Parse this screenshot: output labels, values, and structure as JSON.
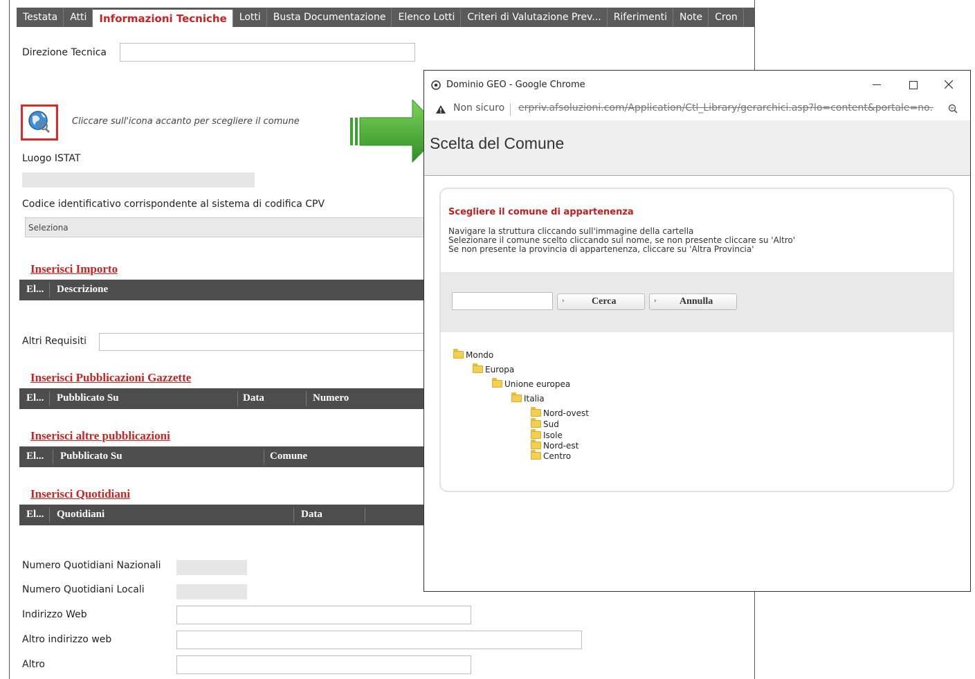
{
  "tabs": [
    "Testata",
    "Atti",
    "Informazioni Tecniche",
    "Lotti",
    "Busta Documentazione",
    "Elenco Lotti",
    "Criteri di Valutazione Prev...",
    "Riferimenti",
    "Note",
    "Cron"
  ],
  "active_tab": "Informazioni Tecniche",
  "form": {
    "direzione_tecnica_label": "Direzione Tecnica",
    "comune_hint": "Cliccare sull'icona accanto per scegliere il comune",
    "luogo_istat_label": "Luogo ISTAT",
    "cpv_label": "Codice identificativo corrispondente al sistema di codifica CPV",
    "cpv_value": "Seleziona",
    "inserisci_importo": "Inserisci Importo",
    "importo_cols": [
      "El...",
      "Descrizione"
    ],
    "altri_requisiti_label": "Altri Requisiti",
    "inserisci_gazzette": "Inserisci Pubblicazioni Gazzette",
    "gazzette_cols": [
      "El...",
      "Pubblicato Su",
      "Data",
      "Numero"
    ],
    "inserisci_altre": "Inserisci altre pubblicazioni",
    "altre_cols": [
      "El...",
      "Pubblicato Su",
      "Comune"
    ],
    "inserisci_quotidiani": "Inserisci Quotidiani",
    "quotidiani_cols": [
      "El...",
      "Quotidiani",
      "Data"
    ],
    "num_nazionali_label": "Numero Quotidiani Nazionali",
    "num_locali_label": "Numero Quotidiani Locali",
    "indirizzo_web_label": "Indirizzo Web",
    "altro_web_label": "Altro indirizzo web",
    "altro_label": "Altro"
  },
  "popup": {
    "window_title": "Dominio GEO - Google Chrome",
    "not_secure": "Non sicuro",
    "url": "erpriv.afsoluzioni.com/Application/Ctl_Library/gerarchici.asp?lo=content&portale=no...",
    "page_title": "Scelta del Comune",
    "heading": "Scegliere il comune di appartenenza",
    "instructions": [
      "Navigare la struttura cliccando sull'immagine della cartella",
      "Selezionare il comune scelto cliccando sul nome, se non presente cliccare su 'Altro'",
      "Se non presente la provincia di appartenenza, cliccare su 'Altra Provincia'"
    ],
    "cerca_label": "Cerca",
    "annulla_label": "Annulla",
    "tree": [
      "Mondo",
      "Europa",
      "Unione europea",
      "Italia",
      "Nord-ovest",
      "Sud",
      "Isole",
      "Nord-est",
      "Centro"
    ]
  },
  "colors": {
    "accent_red": "#cc2222",
    "arrow_green": "#3aa22e",
    "grid_header": "#4d4d4d"
  },
  "icons": [
    "globe-search-icon",
    "chrome-icon",
    "warning-icon",
    "zoom-icon",
    "folder-icon",
    "minimize-icon",
    "maximize-icon",
    "close-icon"
  ]
}
